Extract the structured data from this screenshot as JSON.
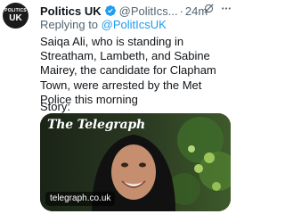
{
  "tweet": {
    "author_name": "Politics UK",
    "handle": "@PolitIcs...",
    "dot": "·",
    "time": "24m",
    "replying_prefix": "Replying to",
    "replying_to": "@PolitIcsUK",
    "text": "Saiqa Ali, who is standing in Streatham, Lambeth, and Sabine Mairey, the candidate for Clapham Town, were arrested by the Met Police this morning",
    "story_label": "Story:",
    "avatar": {
      "top": "POLITICS",
      "bottom": "UK"
    }
  },
  "card": {
    "masthead": "The Telegraph",
    "domain": "telegraph.co.uk"
  },
  "icons": {
    "verified": "verified-badge-icon",
    "grok": "grok-icon",
    "more": "more-icon"
  },
  "colors": {
    "accent": "#1d9bf0",
    "secondary_text": "#536471",
    "primary_text": "#0f1419"
  }
}
